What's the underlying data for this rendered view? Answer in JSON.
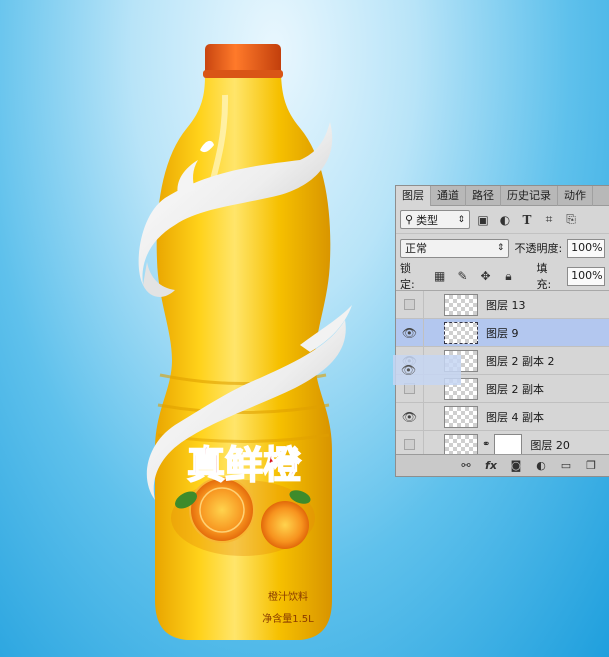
{
  "bottle": {
    "title": "真鲜橙",
    "subtitle": "橙汁饮料",
    "volume": "净含量1.5L"
  },
  "layers_panel": {
    "tabs": [
      "图层",
      "通道",
      "路径",
      "历史记录",
      "动作"
    ],
    "active_tab": "图层",
    "filter_label": "类型",
    "blend_mode": "正常",
    "opacity_label": "不透明度:",
    "opacity_value": "100%",
    "lock_label": "锁定:",
    "fill_label": "填充:",
    "fill_value": "100%",
    "layers": [
      {
        "name": "图层 13",
        "visible": false,
        "selected": false
      },
      {
        "name": "图层 9",
        "visible": true,
        "selected": true
      },
      {
        "name": "图层 2 副本 2",
        "visible": true,
        "selected": false
      },
      {
        "name": "图层 2 副本",
        "visible": false,
        "selected": false
      },
      {
        "name": "图层 4 副本",
        "visible": true,
        "selected": false
      },
      {
        "name": "图层 20",
        "visible": false,
        "selected": false
      }
    ],
    "bottom_icons": [
      "link-icon",
      "fx-icon",
      "mask-icon",
      "adjustment-icon",
      "folder-icon",
      "new-layer-icon"
    ],
    "fx_label": "fx"
  },
  "colors": {
    "bottle_orange": "#f6b800",
    "cap_red": "#e85a1a",
    "panel_bg": "#d6d6d6",
    "selection_blue": "#b3c7ef",
    "background_blue": "#1f9fdd"
  }
}
